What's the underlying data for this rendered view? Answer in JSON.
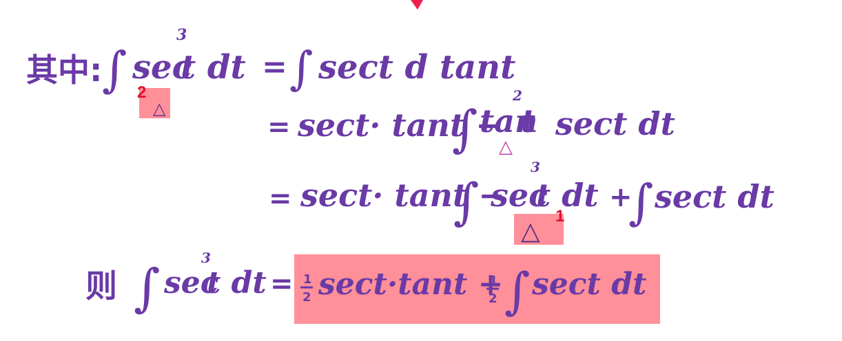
{
  "line1": {
    "prefix": "其中:",
    "lhs_integrand": "sec",
    "lhs_exponent": "3",
    "lhs_var": "t dt",
    "equals": "=",
    "rhs": "sect d tant"
  },
  "line2": {
    "equals": "=",
    "term1": "sect· tant −",
    "integrand": "tan",
    "exponent": "2",
    "var": "t",
    "tail": "sect dt"
  },
  "line3": {
    "equals": "=",
    "term1": "sect· tant −",
    "integrand": "sec",
    "exponent": "3",
    "var": "t dt",
    "plus": "+",
    "tail": "sect dt"
  },
  "line4": {
    "prefix": "则",
    "integrand": "sec",
    "exponent": "3",
    "var": "t dt",
    "equals": "=",
    "half1_num": "1",
    "half1_den": "2",
    "term1": "sect·tant +",
    "half2_num": "1",
    "half2_den": "2",
    "tail": "sect dt"
  },
  "annotations": {
    "triangle": "△",
    "highlight_color": "#ff8f99",
    "marker_color": "#e0102e",
    "markers": [
      {
        "label": "2"
      },
      {
        "label": "1"
      }
    ]
  },
  "colors": {
    "ink": "#6a3aa6",
    "pink_ink": "#c23aa8",
    "red_scribble": "#ee2050"
  }
}
